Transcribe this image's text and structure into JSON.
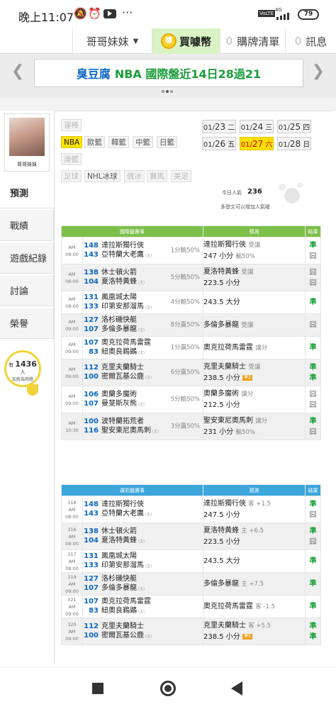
{
  "status": {
    "time": "晚上11:07",
    "battery": "79",
    "network": "4G",
    "volte": "VoLTE"
  },
  "nav": {
    "user": "哥哥妹妹",
    "buy_coins": "買噱幣",
    "coin_glyph": "噱",
    "cart_count": "0",
    "cart": "購牌清單",
    "msg_count": "0",
    "msg": "訊息"
  },
  "banner": {
    "prefix": "臭豆腐",
    "title": "NBA 國際盤近14日28過21"
  },
  "profile": {
    "name": "哥哥妹妹"
  },
  "sidebar": {
    "items": [
      "預測",
      "戰績",
      "遊戲紀錄",
      "討論",
      "榮譽"
    ],
    "online_prefix": "有",
    "online_count": "1436",
    "online_suffix": "人",
    "online_line2": "加我為明燈"
  },
  "leagues": {
    "row1": [
      "運棒"
    ],
    "row2": [
      "NBA",
      "歐籃",
      "韓籃",
      "中籃",
      "日籃"
    ],
    "row3": [
      "澳籃"
    ],
    "row4": [
      "足球",
      "NHL冰球",
      "俄冰",
      "賽馬",
      "美足"
    ]
  },
  "dates": [
    {
      "md": "01/",
      "d": "23",
      "w": "二"
    },
    {
      "md": "01/",
      "d": "24",
      "w": "三"
    },
    {
      "md": "01/",
      "d": "25",
      "w": "四"
    },
    {
      "md": "01/",
      "d": "26",
      "w": "五"
    },
    {
      "md": "01/",
      "d": "27",
      "w": "六"
    },
    {
      "md": "01/",
      "d": "28",
      "w": "日"
    }
  ],
  "popularity": {
    "label": "今日人氣",
    "value": "236",
    "note": "多發文可以增加人氣喔"
  },
  "intl": {
    "headers": [
      "國際盤賽事",
      "預測",
      "結果"
    ],
    "rows": [
      {
        "time": "AM 08:00",
        "g1": "148",
        "t1": "達拉斯獨行俠",
        "g2": "143",
        "t2": "亞特蘭大老鷹",
        "mark": "(主)",
        "line": "1分輸50%",
        "p1": "達拉斯獨行俠",
        "p1s": "受讓",
        "p2": "247 小分",
        "p2s": "輸50%",
        "r1": "準",
        "r2": "囧"
      },
      {
        "time": "AM 08:00",
        "g1": "138",
        "t1": "休士頓火箭",
        "g2": "104",
        "t2": "夏洛特黃蜂",
        "mark": "(主)",
        "line": "5分輸50%",
        "p1": "夏洛特黃蜂",
        "p1s": "受讓",
        "p2": "223.5 小分",
        "p2s": "",
        "r1": "囧",
        "r2": "囧"
      },
      {
        "time": "AM 08:00",
        "g1": "131",
        "t1": "鳳凰城太陽",
        "g2": "133",
        "t2": "印第安那溜馬",
        "mark": "(主)",
        "line": "4分輸50%",
        "p1": "243.5 大分",
        "p1s": "",
        "p2": "",
        "p2s": "",
        "r1": "準",
        "r2": ""
      },
      {
        "time": "AM 09:00",
        "g1": "127",
        "t1": "洛杉磯快艇",
        "g2": "107",
        "t2": "多倫多暴龍",
        "mark": "(主)",
        "line": "8分贏50%",
        "p1": "多倫多暴龍",
        "p1s": "受讓",
        "p2": "",
        "p2s": "",
        "r1": "囧",
        "r2": ""
      },
      {
        "time": "AM 09:00",
        "g1": "107",
        "t1": "奧克拉荷馬雷霆",
        "g2": "83",
        "t2": "紐奧良鵜鶘",
        "mark": "(主)",
        "line": "1分贏50%",
        "p1": "奧克拉荷馬雷霆",
        "p1s": "讓分",
        "p2": "",
        "p2s": "",
        "r1": "準",
        "r2": ""
      },
      {
        "time": "AM 09:00",
        "g1": "112",
        "t1": "克里夫蘭騎士",
        "g2": "100",
        "t2": "密爾瓦基公鹿",
        "mark": "(主)",
        "line": "6分贏50%",
        "p1": "克里夫蘭騎士",
        "p1s": "受讓",
        "p2": "238.5 小分",
        "p2s": "",
        "p2badge": "準3",
        "r1": "準",
        "r2": "準"
      },
      {
        "time": "AM 09:00",
        "g1": "106",
        "t1": "奧蘭多魔術",
        "g2": "107",
        "t2": "曼斐斯灰熊",
        "mark": "(主)",
        "line": "5分輸50%",
        "p1": "奧蘭多魔術",
        "p1s": "讓分",
        "p2": "212.5 小分",
        "p2s": "",
        "r1": "囧",
        "r2": "囧"
      },
      {
        "time": "AM 10:30",
        "g1": "100",
        "t1": "波特蘭拓荒者",
        "g2": "116",
        "t2": "聖安東尼奧馬刺",
        "mark": "(主)",
        "line": "3分贏50%",
        "p1": "聖安東尼奧馬刺",
        "p1s": "讓分",
        "p2": "231 小分",
        "p2s": "輸50%",
        "r1": "準",
        "r2": "囧"
      }
    ]
  },
  "lottery": {
    "headers": [
      "運彩盤賽事",
      "預測",
      "結果"
    ],
    "rows": [
      {
        "no": "318",
        "time": "AM 08:00",
        "g1": "148",
        "t1": "達拉斯獨行俠",
        "g2": "143",
        "t2": "亞特蘭大老鷹",
        "mark": "(主)",
        "p1": "達拉斯獨行俠",
        "p1s": "客 +1.5",
        "p2": "247.5 小分",
        "p2s": "",
        "r1": "準",
        "r2": "囧"
      },
      {
        "no": "316",
        "time": "AM 08:00",
        "g1": "138",
        "t1": "休士頓火箭",
        "g2": "104",
        "t2": "夏洛特黃蜂",
        "mark": "(主)",
        "p1": "夏洛特黃蜂",
        "p1s": "主 +6.5",
        "p2": "223.5 小分",
        "p2s": "",
        "r1": "準",
        "r2": "囧"
      },
      {
        "no": "317",
        "time": "AM 08:00",
        "g1": "131",
        "t1": "鳳凰城太陽",
        "g2": "133",
        "t2": "印第安那溜馬",
        "mark": "(主)",
        "p1": "243.5 大分",
        "p1s": "",
        "p2": "",
        "p2s": "",
        "r1": "準",
        "r2": ""
      },
      {
        "no": "319",
        "time": "AM 09:00",
        "g1": "127",
        "t1": "洛杉磯快艇",
        "g2": "107",
        "t2": "多倫多暴龍",
        "mark": "(主)",
        "p1": "多倫多暴龍",
        "p1s": "主 +7.5",
        "p2": "",
        "p2s": "",
        "r1": "準",
        "r2": ""
      },
      {
        "no": "321",
        "time": "AM 09:00",
        "g1": "107",
        "t1": "奧克拉荷馬雷霆",
        "g2": "83",
        "t2": "紐奧良鵜鶘",
        "mark": "(主)",
        "p1": "奧克拉荷馬雷霆",
        "p1s": "客 -1.5",
        "p2": "",
        "p2s": "",
        "r1": "準",
        "r2": ""
      },
      {
        "no": "320",
        "time": "AM 09:00",
        "g1": "112",
        "t1": "克里夫蘭騎士",
        "g2": "100",
        "t2": "密爾瓦基公鹿",
        "mark": "(主)",
        "p1": "克里夫蘭騎士",
        "p1s": "客 +5.5",
        "p2": "238.5 小分",
        "p2s": "",
        "p2badge": "準5",
        "r1": "準",
        "r2": "準"
      }
    ]
  }
}
